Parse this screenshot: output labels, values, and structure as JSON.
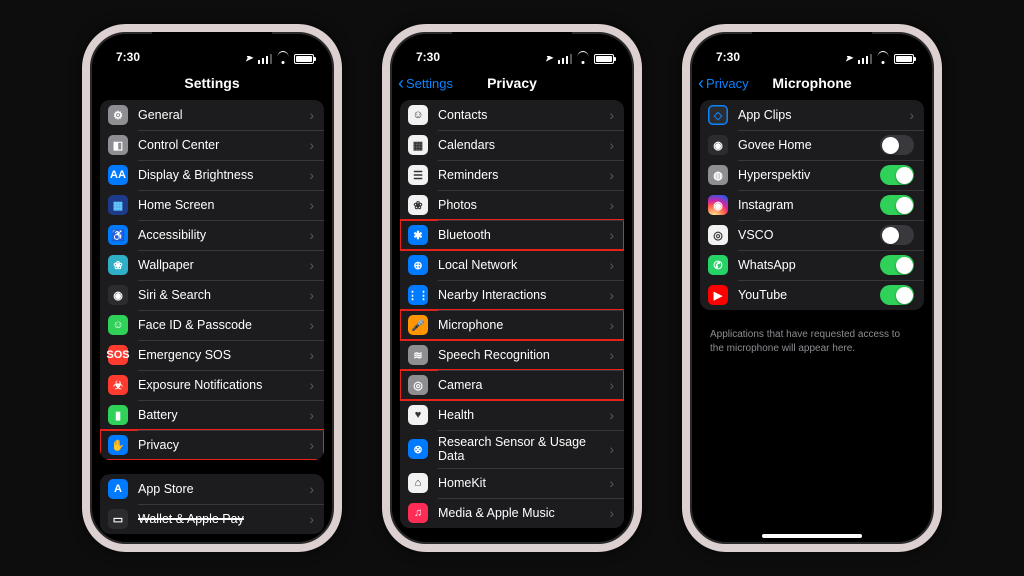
{
  "status": {
    "time": "7:30",
    "loc": "➤"
  },
  "phone1": {
    "title": "Settings",
    "group1": [
      {
        "icon": "⚙",
        "bg": "bg-gray",
        "label": "General"
      },
      {
        "icon": "◧",
        "bg": "bg-gray",
        "label": "Control Center"
      },
      {
        "icon": "AA",
        "bg": "bg-blue",
        "label": "Display & Brightness"
      },
      {
        "icon": "▦",
        "bg": "bg-dblue",
        "label": "Home Screen"
      },
      {
        "icon": "♿",
        "bg": "bg-blue",
        "label": "Accessibility"
      },
      {
        "icon": "❀",
        "bg": "bg-teal",
        "label": "Wallpaper"
      },
      {
        "icon": "◉",
        "bg": "bg-black",
        "label": "Siri & Search"
      },
      {
        "icon": "☺",
        "bg": "bg-green",
        "label": "Face ID & Passcode"
      },
      {
        "icon": "SOS",
        "bg": "bg-red",
        "label": "Emergency SOS"
      },
      {
        "icon": "☣",
        "bg": "bg-red",
        "label": "Exposure Notifications"
      },
      {
        "icon": "▮",
        "bg": "bg-green",
        "label": "Battery"
      },
      {
        "icon": "✋",
        "bg": "bg-blue",
        "label": "Privacy",
        "hl": true
      }
    ],
    "group2": [
      {
        "icon": "A",
        "bg": "bg-blue",
        "label": "App Store"
      },
      {
        "icon": "▭",
        "bg": "bg-black",
        "label": "Wallet & Apple Pay",
        "strike": true
      }
    ]
  },
  "phone2": {
    "back": "Settings",
    "title": "Privacy",
    "items": [
      {
        "icon": "☺",
        "bg": "bg-white",
        "label": "Contacts"
      },
      {
        "icon": "▦",
        "bg": "bg-white",
        "label": "Calendars"
      },
      {
        "icon": "☰",
        "bg": "bg-white",
        "label": "Reminders"
      },
      {
        "icon": "❀",
        "bg": "bg-white",
        "label": "Photos"
      },
      {
        "icon": "✱",
        "bg": "bg-blue",
        "label": "Bluetooth",
        "hl": true
      },
      {
        "icon": "⊕",
        "bg": "bg-blue",
        "label": "Local Network"
      },
      {
        "icon": "⋮⋮",
        "bg": "bg-blue",
        "label": "Nearby Interactions"
      },
      {
        "icon": "🎤",
        "bg": "bg-orange",
        "label": "Microphone",
        "hl": true
      },
      {
        "icon": "≋",
        "bg": "bg-gray",
        "label": "Speech Recognition"
      },
      {
        "icon": "◎",
        "bg": "bg-gray",
        "label": "Camera",
        "hl": true
      },
      {
        "icon": "♥",
        "bg": "bg-white",
        "label": "Health"
      },
      {
        "icon": "⊗",
        "bg": "bg-blue",
        "label": "Research Sensor & Usage Data",
        "tall": true
      },
      {
        "icon": "⌂",
        "bg": "bg-white",
        "label": "HomeKit"
      },
      {
        "icon": "♫",
        "bg": "bg-pink",
        "label": "Media & Apple Music"
      }
    ]
  },
  "phone3": {
    "back": "Privacy",
    "title": "Microphone",
    "items": [
      {
        "icon": "◇",
        "bg": "bg-outline",
        "label": "App Clips",
        "type": "chev"
      },
      {
        "icon": "◉",
        "bg": "bg-black",
        "label": "Govee Home",
        "type": "toggle",
        "on": false
      },
      {
        "icon": "◍",
        "bg": "bg-gray",
        "label": "Hyperspektiv",
        "type": "toggle",
        "on": true
      },
      {
        "icon": "◉",
        "bg": "bg-insta",
        "label": "Instagram",
        "type": "toggle",
        "on": true
      },
      {
        "icon": "◎",
        "bg": "bg-white",
        "label": "VSCO",
        "type": "toggle",
        "on": false
      },
      {
        "icon": "✆",
        "bg": "bg-wa",
        "label": "WhatsApp",
        "type": "toggle",
        "on": true
      },
      {
        "icon": "▶",
        "bg": "bg-yt",
        "label": "YouTube",
        "type": "toggle",
        "on": true
      }
    ],
    "note": "Applications that have requested access to the microphone will appear here."
  }
}
